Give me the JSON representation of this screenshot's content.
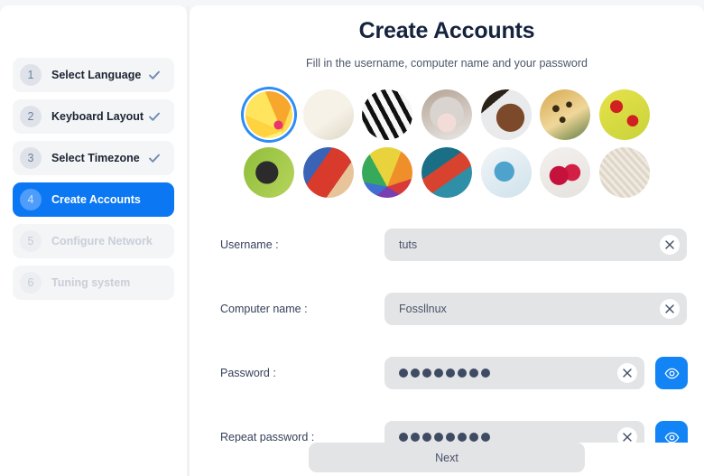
{
  "sidebar": {
    "steps": [
      {
        "number": "1",
        "label": "Select Language",
        "state": "done"
      },
      {
        "number": "2",
        "label": "Keyboard Layout",
        "state": "done"
      },
      {
        "number": "3",
        "label": "Select Timezone",
        "state": "done"
      },
      {
        "number": "4",
        "label": "Create Accounts",
        "state": "active"
      },
      {
        "number": "5",
        "label": "Configure Network",
        "state": "disabled"
      },
      {
        "number": "6",
        "label": "Tuning system",
        "state": "disabled"
      }
    ]
  },
  "main": {
    "title": "Create Accounts",
    "subtitle": "Fill in the username, computer name and your password",
    "avatars": [
      {
        "name": "avatar-flower",
        "selected": true
      },
      {
        "name": "avatar-clock",
        "selected": false
      },
      {
        "name": "avatar-piano",
        "selected": false
      },
      {
        "name": "avatar-cat",
        "selected": false
      },
      {
        "name": "avatar-horse",
        "selected": false
      },
      {
        "name": "avatar-leopard",
        "selected": false
      },
      {
        "name": "avatar-ladybugs",
        "selected": false
      },
      {
        "name": "avatar-butterfly",
        "selected": false
      },
      {
        "name": "avatar-abstract-red",
        "selected": false
      },
      {
        "name": "avatar-rainbow-umbrella",
        "selected": false
      },
      {
        "name": "avatar-abstract-teal",
        "selected": false
      },
      {
        "name": "avatar-watercolor-blue",
        "selected": false
      },
      {
        "name": "avatar-raspberries",
        "selected": false
      },
      {
        "name": "avatar-beige-texture",
        "selected": false
      }
    ],
    "fields": {
      "username": {
        "label": "Username :",
        "value": "tuts",
        "placeholder": "",
        "clear_icon": "close-icon"
      },
      "computer_name": {
        "label": "Computer name :",
        "value": "Fossllnux",
        "placeholder": "",
        "clear_icon": "close-icon"
      },
      "password": {
        "label": "Password :",
        "masked_length": 8,
        "clear_icon": "close-icon",
        "reveal_icon": "eye-icon"
      },
      "repeat_password": {
        "label": "Repeat password :",
        "masked_length": 8,
        "clear_icon": "close-icon",
        "reveal_icon": "eye-icon"
      }
    }
  },
  "footer": {
    "next_label": "Next"
  },
  "colors": {
    "accent": "#0c77f2",
    "accent_button": "#1384f5",
    "selection_ring": "#2d8cf5",
    "input_bg": "#e3e4e6",
    "title": "#15233d",
    "check": "#7189b4"
  }
}
